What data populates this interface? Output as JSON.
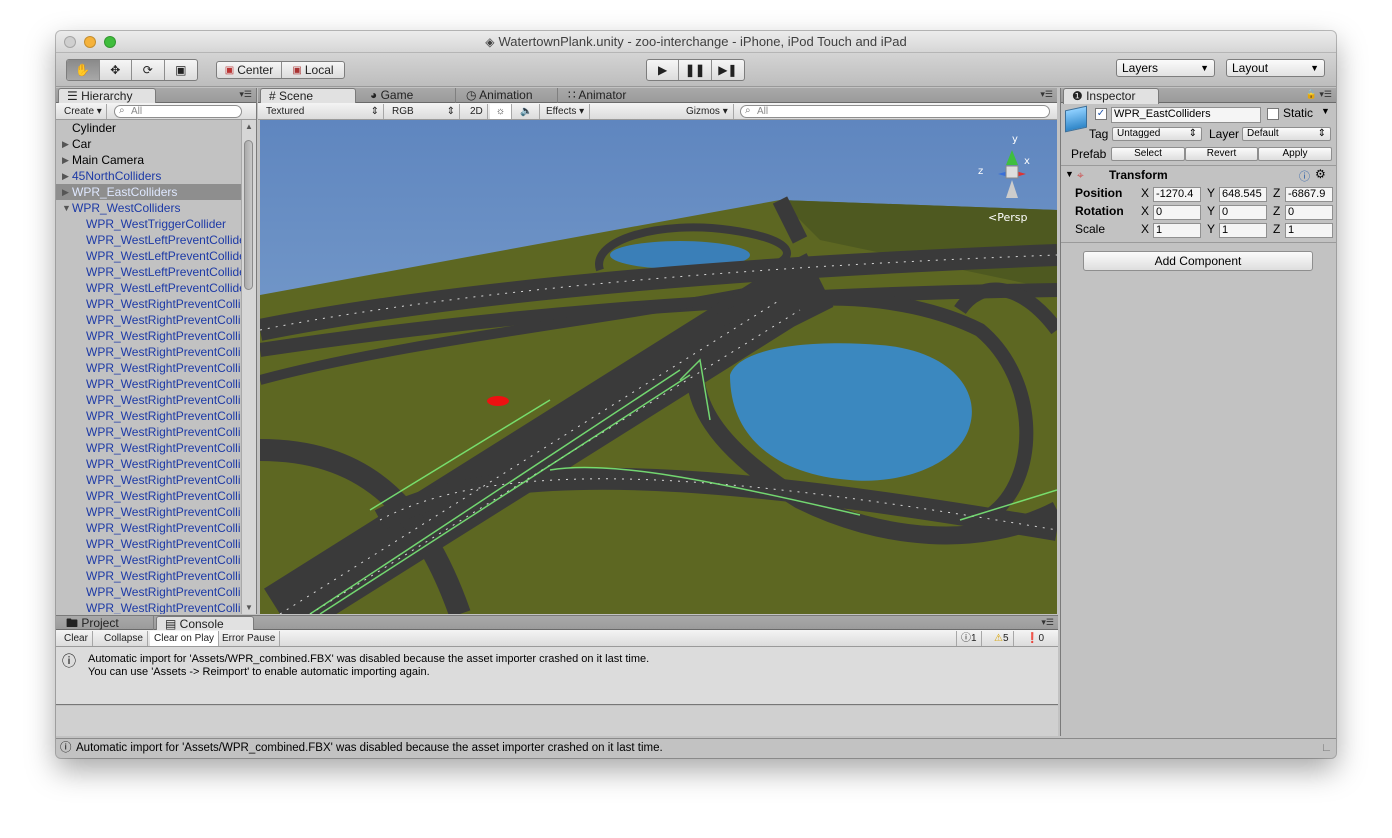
{
  "window": {
    "title": "WatertownPlank.unity - zoo-interchange - iPhone, iPod Touch and iPad"
  },
  "toolbar": {
    "pivot": "Center",
    "space": "Local",
    "layers": "Layers",
    "layout": "Layout"
  },
  "hierarchy": {
    "tab": "Hierarchy",
    "create": "Create",
    "search_placeholder": "All",
    "items": [
      {
        "label": "Cylinder",
        "indent": 0,
        "arrow": "",
        "style": "normal"
      },
      {
        "label": "Car",
        "indent": 0,
        "arrow": "right",
        "style": "normal"
      },
      {
        "label": "Main Camera",
        "indent": 0,
        "arrow": "right",
        "style": "normal"
      },
      {
        "label": "45NorthColliders",
        "indent": 0,
        "arrow": "right",
        "style": "prefab"
      },
      {
        "label": "WPR_EastColliders",
        "indent": 0,
        "arrow": "right",
        "style": "selected"
      },
      {
        "label": "WPR_WestColliders",
        "indent": 0,
        "arrow": "down",
        "style": "prefab"
      },
      {
        "label": "WPR_WestTriggerCollider",
        "indent": 1,
        "arrow": "",
        "style": "prefab"
      },
      {
        "label": "WPR_WestLeftPreventCollider",
        "indent": 1,
        "arrow": "",
        "style": "prefab"
      },
      {
        "label": "WPR_WestLeftPreventCollider",
        "indent": 1,
        "arrow": "",
        "style": "prefab"
      },
      {
        "label": "WPR_WestLeftPreventCollider",
        "indent": 1,
        "arrow": "",
        "style": "prefab"
      },
      {
        "label": "WPR_WestLeftPreventCollider",
        "indent": 1,
        "arrow": "",
        "style": "prefab"
      },
      {
        "label": "WPR_WestRightPreventCollide",
        "indent": 1,
        "arrow": "",
        "style": "prefab"
      },
      {
        "label": "WPR_WestRightPreventCollide",
        "indent": 1,
        "arrow": "",
        "style": "prefab"
      },
      {
        "label": "WPR_WestRightPreventCollide",
        "indent": 1,
        "arrow": "",
        "style": "prefab"
      },
      {
        "label": "WPR_WestRightPreventCollide",
        "indent": 1,
        "arrow": "",
        "style": "prefab"
      },
      {
        "label": "WPR_WestRightPreventCollide",
        "indent": 1,
        "arrow": "",
        "style": "prefab"
      },
      {
        "label": "WPR_WestRightPreventCollide",
        "indent": 1,
        "arrow": "",
        "style": "prefab"
      },
      {
        "label": "WPR_WestRightPreventCollide",
        "indent": 1,
        "arrow": "",
        "style": "prefab"
      },
      {
        "label": "WPR_WestRightPreventCollide",
        "indent": 1,
        "arrow": "",
        "style": "prefab"
      },
      {
        "label": "WPR_WestRightPreventCollide",
        "indent": 1,
        "arrow": "",
        "style": "prefab"
      },
      {
        "label": "WPR_WestRightPreventCollide",
        "indent": 1,
        "arrow": "",
        "style": "prefab"
      },
      {
        "label": "WPR_WestRightPreventCollide",
        "indent": 1,
        "arrow": "",
        "style": "prefab"
      },
      {
        "label": "WPR_WestRightPreventCollide",
        "indent": 1,
        "arrow": "",
        "style": "prefab"
      },
      {
        "label": "WPR_WestRightPreventCollide",
        "indent": 1,
        "arrow": "",
        "style": "prefab"
      },
      {
        "label": "WPR_WestRightPreventCollide",
        "indent": 1,
        "arrow": "",
        "style": "prefab"
      },
      {
        "label": "WPR_WestRightPreventCollide",
        "indent": 1,
        "arrow": "",
        "style": "prefab"
      },
      {
        "label": "WPR_WestRightPreventCollide",
        "indent": 1,
        "arrow": "",
        "style": "prefab"
      },
      {
        "label": "WPR_WestRightPreventCollide",
        "indent": 1,
        "arrow": "",
        "style": "prefab"
      },
      {
        "label": "WPR_WestRightPreventCollide",
        "indent": 1,
        "arrow": "",
        "style": "prefab"
      },
      {
        "label": "WPR_WestRightPreventCollide",
        "indent": 1,
        "arrow": "",
        "style": "prefab"
      },
      {
        "label": "WPR_WestRightPreventCollide",
        "indent": 1,
        "arrow": "",
        "style": "prefab"
      },
      {
        "label": "WPR_WestRightPreventCollide",
        "indent": 1,
        "arrow": "",
        "style": "prefab"
      }
    ]
  },
  "scene": {
    "tabs": [
      "Scene",
      "Game",
      "Animation",
      "Animator"
    ],
    "draw_mode": "Textured",
    "render_mode": "RGB",
    "mode_2d": "2D",
    "effects": "Effects",
    "gizmos": "Gizmos",
    "search_placeholder": "All",
    "persp": "Persp",
    "axis_labels": {
      "x": "x",
      "y": "y",
      "z": "z"
    }
  },
  "inspector": {
    "tab": "Inspector",
    "object_name": "WPR_EastColliders",
    "static_label": "Static",
    "tag_label": "Tag",
    "tag_value": "Untagged",
    "layer_label": "Layer",
    "layer_value": "Default",
    "prefab_label": "Prefab",
    "prefab_buttons": [
      "Select",
      "Revert",
      "Apply"
    ],
    "transform_title": "Transform",
    "rows": [
      {
        "label": "Position",
        "x": "-1270.4",
        "y": "648.545",
        "z": "-6867.9"
      },
      {
        "label": "Rotation",
        "x": "0",
        "y": "0",
        "z": "0"
      },
      {
        "label": "Scale",
        "x": "1",
        "y": "1",
        "z": "1"
      }
    ],
    "axis": {
      "x": "X",
      "y": "Y",
      "z": "Z"
    },
    "add_component": "Add Component"
  },
  "bottom": {
    "tabs": [
      "Project",
      "Console"
    ],
    "buttons": [
      "Clear",
      "Collapse",
      "Clear on Play",
      "Error Pause"
    ],
    "counts": {
      "info": "1",
      "warn": "5",
      "error": "0"
    },
    "message_line1": "Automatic import for 'Assets/WPR_combined.FBX' was disabled because the asset importer crashed on it last time.",
    "message_line2": "You can use 'Assets -> Reimport' to enable automatic importing again."
  },
  "status": {
    "text": "Automatic import for 'Assets/WPR_combined.FBX' was disabled because the asset importer crashed on it last time."
  },
  "colors": {
    "prefab_text": "#1d3aa6",
    "selected_row": "#8e8e8e",
    "sky": "#6f95c4",
    "grass": "#5a6420",
    "water": "#3b88bf"
  }
}
